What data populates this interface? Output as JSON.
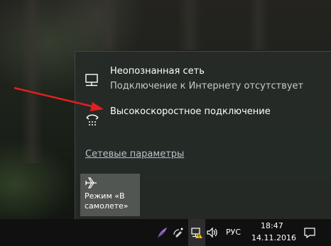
{
  "network_flyout": {
    "networks": [
      {
        "name": "Неопознанная сеть",
        "status": "Подключение к Интернету отсутствует",
        "icon": "wired-network-icon"
      },
      {
        "name": "Высокоскоростное подключение",
        "icon": "dialup-connection-icon"
      }
    ],
    "settings_link": "Сетевые параметры",
    "quick_actions": [
      {
        "label": "Режим «В самолете»",
        "icon": "airplane-icon"
      }
    ]
  },
  "taskbar": {
    "tray_icons": [
      "feather-app-icon",
      "satellite-icon",
      "network-icon",
      "volume-icon"
    ],
    "language": "РУС",
    "time": "18:47",
    "date": "14.11.2016",
    "action_center_icon": "action-center-icon"
  },
  "colors": {
    "flyout_bg": "#262b28",
    "annotation_arrow": "#e02020",
    "link": "#b9c3cc",
    "taskbar_bg": "#101010"
  }
}
